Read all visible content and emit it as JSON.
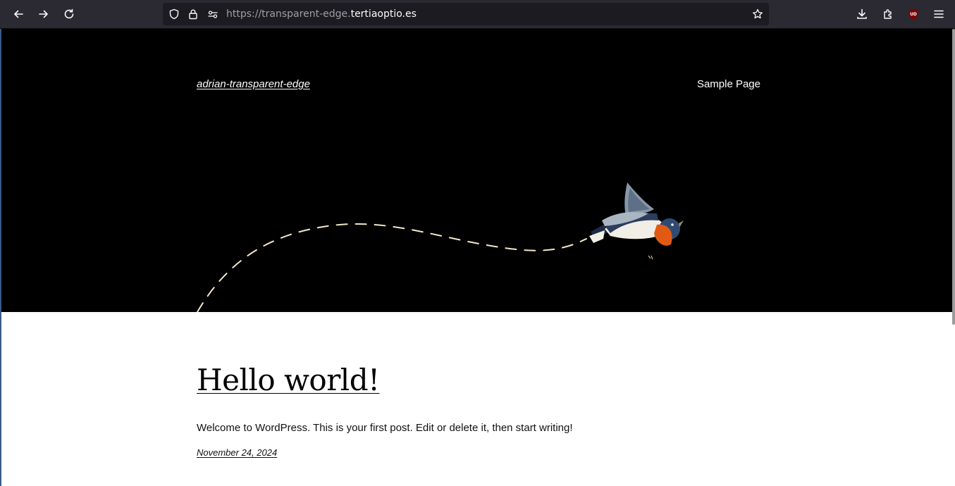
{
  "browser": {
    "url_prefix": "https://transparent-edge.",
    "url_domain": "tertiaoptio.es",
    "icons": {
      "back": "arrow-left-icon",
      "forward": "arrow-right-icon",
      "reload": "reload-icon",
      "tracking_protection": "shield-icon",
      "secure": "lock-icon",
      "permissions": "permissions-icon",
      "bookmark": "star-icon",
      "downloads": "download-icon",
      "extensions": "puzzle-icon",
      "ublock": "ublock-icon",
      "menu": "hamburger-menu-icon"
    },
    "ublock_label": "UD"
  },
  "site": {
    "title": "adrian-transparent-edge",
    "nav": [
      {
        "label": "Sample Page"
      }
    ],
    "colors": {
      "hero_bg": "#000000",
      "page_bg": "#ffffff",
      "path_dash": "#f3e7c9"
    }
  },
  "post": {
    "title": "Hello world!",
    "excerpt": "Welcome to WordPress. This is your first post. Edit or delete it, then start writing!",
    "date": "November 24, 2024"
  }
}
